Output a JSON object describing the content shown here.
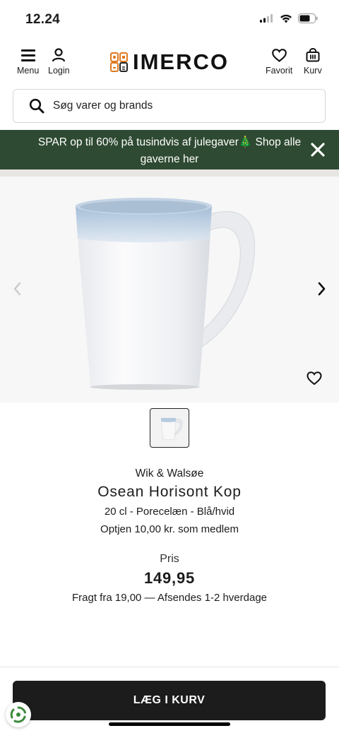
{
  "status_bar": {
    "time": "12.24"
  },
  "header": {
    "menu_label": "Menu",
    "login_label": "Login",
    "logo_text": "IMERCO",
    "favorites_label": "Favorit",
    "cart_label": "Kurv"
  },
  "search": {
    "placeholder": "Søg varer og brands"
  },
  "promo": {
    "text": "SPAR op til 60% på tusindvis af julegaver🎄 Shop alle gaverne her"
  },
  "product": {
    "brand": "Wik & Walsøe",
    "name": "Osean Horisont Kop",
    "spec": "20 cl - Porecelæn - Blå/hvid",
    "member_text": "Optjen 10,00 kr. som medlem",
    "price_label": "Pris",
    "price": "149,95",
    "shipping": "Fragt fra 19,00 — Afsendes 1-2 hverdage"
  },
  "actions": {
    "add_to_cart": "LÆG I KURV"
  },
  "colors": {
    "banner_bg": "#2e4a32",
    "button_bg": "#1c1c1c",
    "mug_rim": "#a9c3dc"
  },
  "icons": [
    "menu-icon",
    "user-icon",
    "heart-icon",
    "basket-icon",
    "search-icon",
    "close-icon",
    "chevron-left-icon",
    "chevron-right-icon",
    "recycle-icon"
  ]
}
